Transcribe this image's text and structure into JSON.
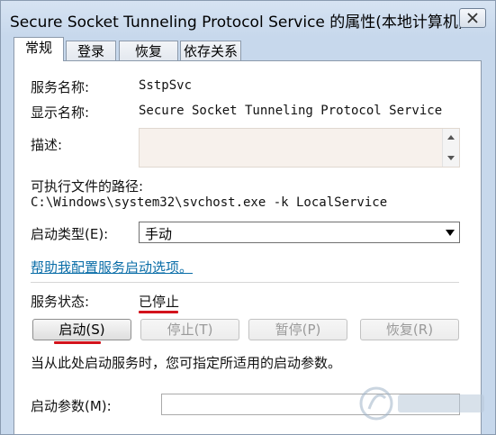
{
  "window": {
    "title": "Secure Socket Tunneling Protocol Service 的属性(本地计算机)"
  },
  "tabs": [
    {
      "label": "常规",
      "active": true
    },
    {
      "label": "登录",
      "active": false
    },
    {
      "label": "恢复",
      "active": false
    },
    {
      "label": "依存关系",
      "active": false
    }
  ],
  "general": {
    "service_name_label": "服务名称:",
    "service_name_value": "SstpSvc",
    "display_name_label": "显示名称:",
    "display_name_value": "Secure Socket Tunneling Protocol Service",
    "description_label": "描述:",
    "path_label": "可执行文件的路径:",
    "path_value": "C:\\Windows\\system32\\svchost.exe -k LocalService",
    "startup_type_label": "启动类型(E):",
    "startup_type_value": "手动",
    "help_link": "帮助我配置服务启动选项。",
    "status_label": "服务状态:",
    "status_value": "已停止",
    "buttons": {
      "start": "启动(S)",
      "stop": "停止(T)",
      "pause": "暂停(P)",
      "resume": "恢复(R)"
    },
    "hint": "当从此处启动服务时，您可指定所适用的启动参数。",
    "start_params_label": "启动参数(M):"
  },
  "colors": {
    "highlight_red": "#d3131c",
    "link_blue": "#0b6ea8",
    "titlebar_blue": "#c7d8ec"
  }
}
